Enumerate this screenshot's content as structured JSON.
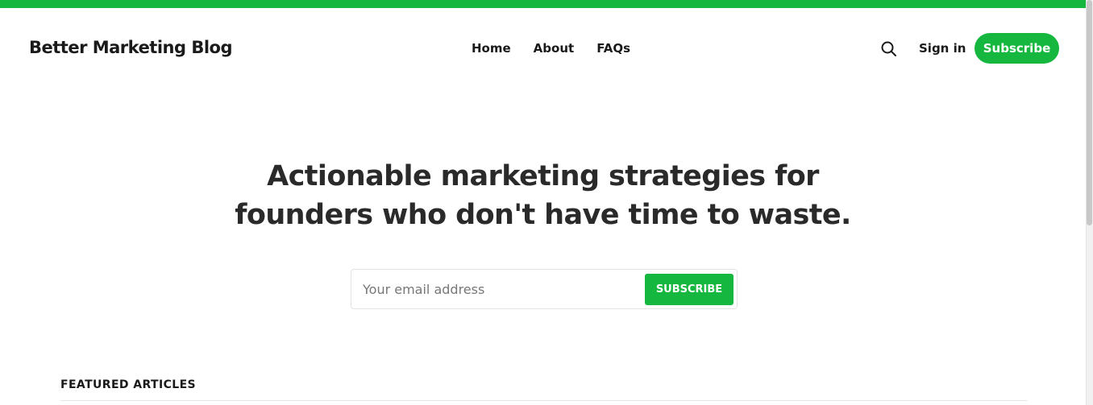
{
  "header": {
    "brand": "Better Marketing Blog",
    "nav": [
      "Home",
      "About",
      "FAQs"
    ],
    "sign_in": "Sign in",
    "subscribe": "Subscribe"
  },
  "hero": {
    "line1": "Actionable marketing strategies for",
    "line2": "founders who don't have time to waste."
  },
  "signup": {
    "email_placeholder": "Your email address",
    "email_value": "",
    "button": "SUBSCRIBE"
  },
  "featured": {
    "title": "FEATURED ARTICLES"
  },
  "icons": {
    "search": "search-icon"
  },
  "colors": {
    "accent": "#15b73e",
    "text": "#1a1a1a"
  }
}
